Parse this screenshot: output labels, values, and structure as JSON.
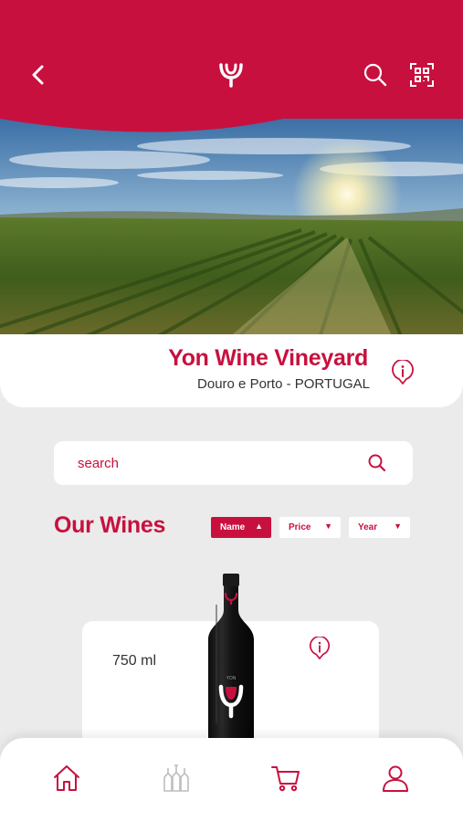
{
  "header": {
    "back_icon": "chevron-left-icon",
    "logo_icon": "glass-logo-icon",
    "search_icon": "search-icon",
    "scan_icon": "qr-scan-icon",
    "background_color": "#c8103e"
  },
  "vineyard": {
    "name": "Yon Wine Vineyard",
    "location": "Douro e Porto - PORTUGAL",
    "info_icon": "info-pin-icon"
  },
  "search": {
    "placeholder": "search",
    "icon": "search-icon"
  },
  "wines": {
    "title": "Our Wines",
    "sort": [
      {
        "label": "Name",
        "direction": "up",
        "active": true
      },
      {
        "label": "Price",
        "direction": "down",
        "active": false
      },
      {
        "label": "Year",
        "direction": "down",
        "active": false
      }
    ],
    "items": [
      {
        "volume": "750 ml",
        "bottle_label": "YON"
      }
    ]
  },
  "bottom_nav": {
    "items": [
      {
        "name": "home",
        "icon": "home-icon"
      },
      {
        "name": "wines",
        "icon": "bottles-icon"
      },
      {
        "name": "cart",
        "icon": "cart-icon"
      },
      {
        "name": "profile",
        "icon": "user-icon"
      }
    ]
  },
  "colors": {
    "accent": "#c8103e",
    "background": "#ebebeb",
    "card": "#ffffff"
  }
}
